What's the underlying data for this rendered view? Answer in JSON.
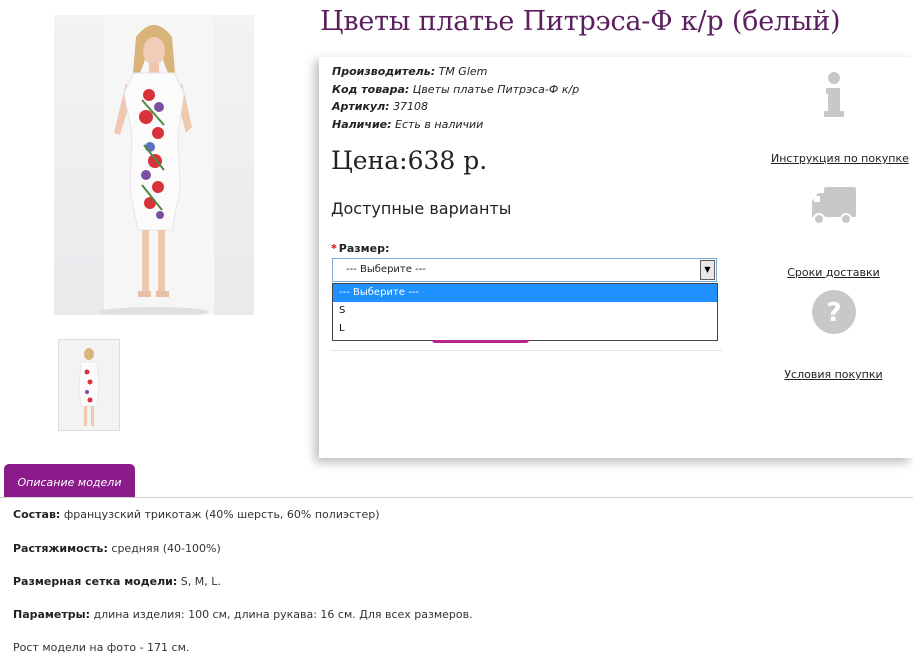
{
  "product": {
    "title": "Цветы платье Питрэса-Ф к/р (белый)",
    "meta": [
      {
        "label": "Производитель:",
        "value": "TM Glem"
      },
      {
        "label": "Код товара:",
        "value": "Цветы платье Питрэса-Ф к/р"
      },
      {
        "label": "Артикул:",
        "value": "37108"
      },
      {
        "label": "Наличие:",
        "value": "Есть в наличии"
      }
    ],
    "price": "Цена:638 р.",
    "variants_heading": "Доступные варианты",
    "size": {
      "required_mark": "*",
      "label": "Размер:",
      "selected": "--- Выберите ---",
      "options": [
        "--- Выберите ---",
        "S",
        "L"
      ]
    }
  },
  "sidebar": [
    {
      "icon": "info-icon",
      "label": "Инструкция по покупке"
    },
    {
      "icon": "truck-icon",
      "label": "Сроки доставки"
    },
    {
      "icon": "question-icon",
      "label": "Условия покупки"
    }
  ],
  "tabs": {
    "description": "Описание модели"
  },
  "description": [
    {
      "label": "Состав:",
      "text": "французский трикотаж (40% шерсть, 60% полиэстер)"
    },
    {
      "label": "Растяжимость:",
      "text": "средняя (40-100%)"
    },
    {
      "label": "Размерная сетка модели:",
      "text": "S, M, L."
    },
    {
      "label": "Параметры:",
      "text": "длина изделия: 100 см, длина рукава: 16 см. Для всех размеров."
    },
    {
      "label": "",
      "text": "Рост модели на фото - 171 см."
    }
  ],
  "colors": {
    "title": "#5a1f5c",
    "tab": "#8b1b8b",
    "dropdown_highlight": "#1e90ff",
    "icon_grey": "#c8c8c8"
  }
}
